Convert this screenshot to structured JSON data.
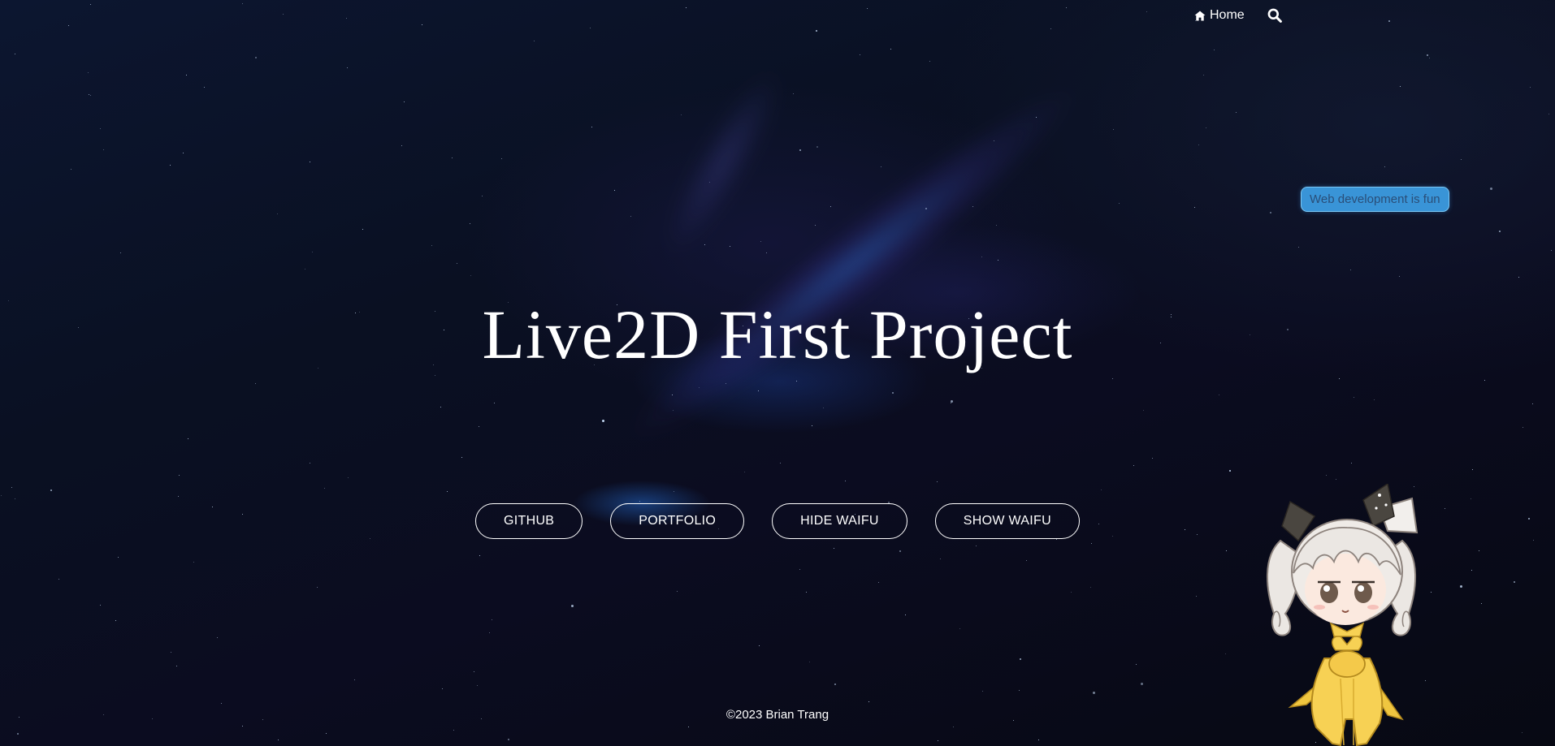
{
  "nav": {
    "home_label": "Home",
    "home_icon": "home-icon",
    "search_icon": "search-icon"
  },
  "bubble": {
    "text": "Web development is fun"
  },
  "hero": {
    "title": "Live2D First Project"
  },
  "buttons": [
    {
      "label": "GITHUB"
    },
    {
      "label": "PORTFOLIO"
    },
    {
      "label": "HIDE WAIFU"
    },
    {
      "label": "SHOW WAIFU"
    }
  ],
  "footer": {
    "text": "©2023 Brian Trang"
  },
  "colors": {
    "background": "#070b18",
    "bubble": "#3da0e6",
    "bubble_text": "#2a4e78",
    "text": "#ffffff"
  }
}
